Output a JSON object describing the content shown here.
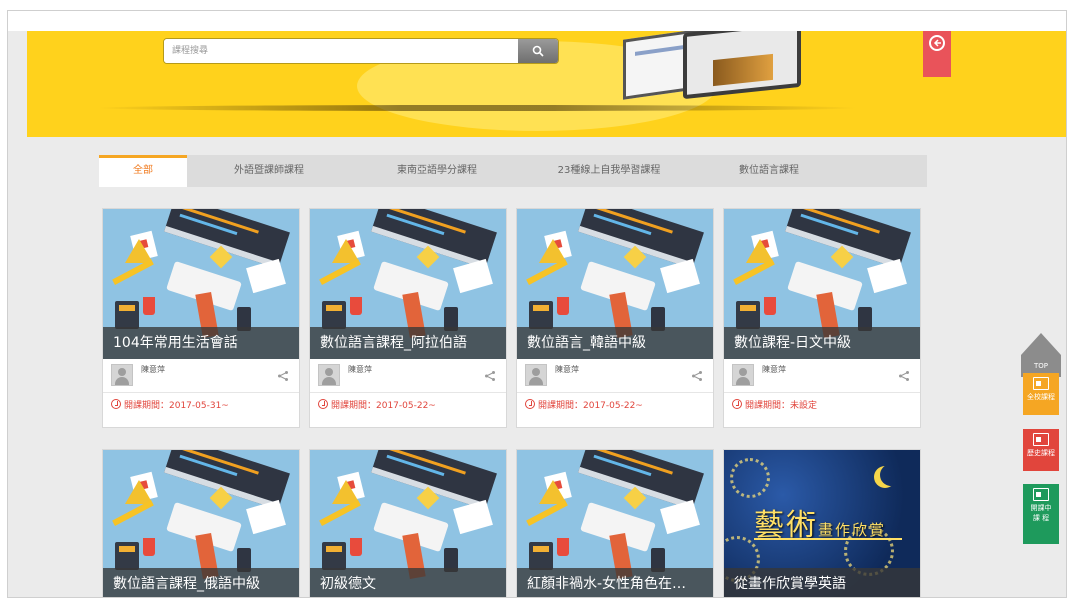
{
  "search": {
    "placeholder": "課程搜尋"
  },
  "tabs": [
    {
      "label": "全部",
      "active": true
    },
    {
      "label": "外語暨課師課程",
      "active": false
    },
    {
      "label": "東南亞語學分課程",
      "active": false
    },
    {
      "label": "23種線上自我學習課程",
      "active": false
    },
    {
      "label": "數位語言課程",
      "active": false
    }
  ],
  "courses": [
    {
      "title": "104年常用生活會話",
      "teacher": "陳意萍",
      "date": "開課期間：2017-05-31~",
      "thumb": "desk-illustration"
    },
    {
      "title": "數位語言課程_阿拉伯語",
      "teacher": "陳意萍",
      "date": "開課期間：2017-05-22~",
      "thumb": "desk-illustration"
    },
    {
      "title": "數位語言_韓語中級",
      "teacher": "陳意萍",
      "date": "開課期間：2017-05-22~",
      "thumb": "desk-illustration"
    },
    {
      "title": "數位課程-日文中級",
      "teacher": "陳意萍",
      "date": "開課期間：未設定",
      "thumb": "desk-illustration"
    },
    {
      "title": "數位語言課程_俄語中級",
      "thumb": "desk-illustration"
    },
    {
      "title": "初級德文",
      "thumb": "desk-illustration"
    },
    {
      "title": "紅顏非禍水-女性角色在…",
      "thumb": "desk-illustration"
    },
    {
      "title": "從畫作欣賞學英語",
      "thumb": "starry-night-art",
      "art_title_big": "藝術",
      "art_title_small": "畫作欣賞"
    }
  ],
  "side_tools": {
    "top_label": "TOP",
    "all_courses": "全校課程",
    "history_courses": "歷史課程",
    "ongoing_courses_line1": "開課中",
    "ongoing_courses_line2": "課 程"
  },
  "colors": {
    "banner": "#ffd21c",
    "tab_active": "#f07a1e",
    "date_red": "#e1453c",
    "tool_orange": "#f5a623",
    "tool_red": "#e1453c",
    "tool_green": "#1e9a5c"
  },
  "icons": {
    "search": "search-icon",
    "back": "back-circle-arrow-icon",
    "share": "share-icon",
    "clock": "clock-icon",
    "avatar": "user-avatar-placeholder"
  }
}
